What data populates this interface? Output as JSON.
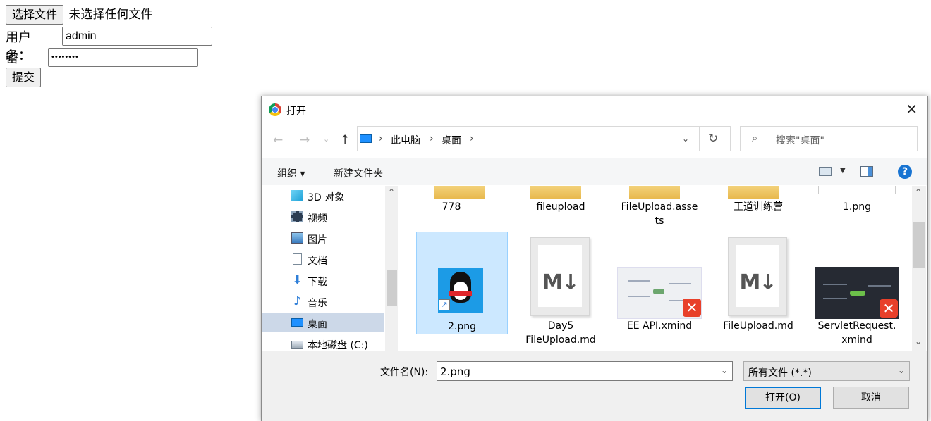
{
  "form": {
    "file_button": "选择文件",
    "file_status": "未选择任何文件",
    "username_label": "用户名：",
    "username_value": "admin",
    "password_label": "密码：",
    "password_value": "••••••••",
    "submit_button": "提交"
  },
  "dialog": {
    "title": "打开",
    "breadcrumb": [
      "此电脑",
      "桌面"
    ],
    "search_placeholder": "搜索\"桌面\"",
    "toolbar": {
      "organize": "组织 ▾",
      "new_folder": "新建文件夹"
    },
    "tree": [
      {
        "label": "3D 对象",
        "icon": "3d-objects-icon"
      },
      {
        "label": "视频",
        "icon": "video-icon"
      },
      {
        "label": "图片",
        "icon": "pictures-icon"
      },
      {
        "label": "文档",
        "icon": "documents-icon"
      },
      {
        "label": "下载",
        "icon": "download-icon"
      },
      {
        "label": "音乐",
        "icon": "music-icon"
      },
      {
        "label": "桌面",
        "icon": "desktop-icon",
        "selected": true
      },
      {
        "label": "本地磁盘 (C:)",
        "icon": "drive-icon"
      }
    ],
    "files_row1": [
      {
        "name": "778",
        "type": "folder"
      },
      {
        "name": "fileupload",
        "type": "folder"
      },
      {
        "name": "FileUpload.asse",
        "name2": "ts",
        "type": "folder"
      },
      {
        "name": "王道训练营",
        "type": "folder"
      },
      {
        "name": "1.png",
        "type": "image"
      }
    ],
    "files_row2": [
      {
        "name": "2.png",
        "type": "png-qq",
        "selected": true
      },
      {
        "name": "Day5",
        "name2": "FileUpload.md",
        "type": "markdown"
      },
      {
        "name": "EE API.xmind",
        "type": "xmind-light"
      },
      {
        "name": "FileUpload.md",
        "type": "markdown"
      },
      {
        "name": "ServletRequest.",
        "name2": "xmind",
        "type": "xmind-dark"
      }
    ],
    "filename_label": "文件名(N):",
    "filename_value": "2.png",
    "filetype_value": "所有文件 (*.*)",
    "open_button": "打开(O)",
    "cancel_button": "取消",
    "md_mark": "M↓"
  },
  "colors": {
    "selection": "#cce8ff",
    "accent": "#0078d7",
    "xmind": "#e8402a"
  }
}
